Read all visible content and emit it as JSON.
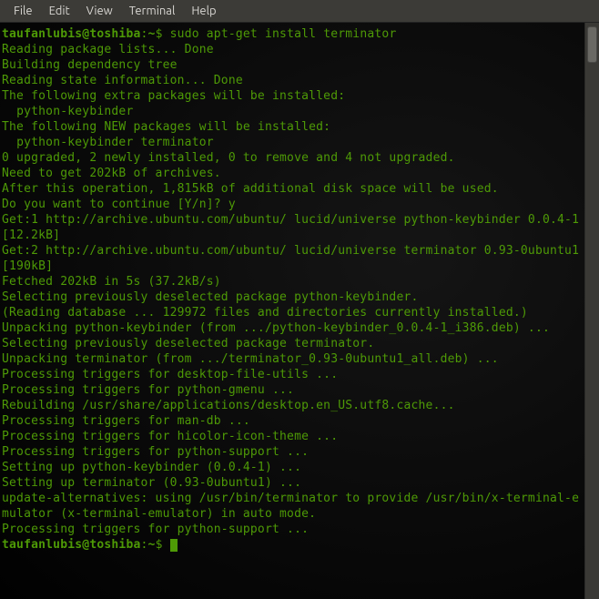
{
  "menubar": {
    "items": [
      "File",
      "Edit",
      "View",
      "Terminal",
      "Help"
    ]
  },
  "prompt": {
    "user_host": "taufanlubis@toshiba",
    "path": "~",
    "symbol": "$"
  },
  "command": "sudo apt-get install terminator",
  "output_lines": [
    "Reading package lists... Done",
    "Building dependency tree       ",
    "Reading state information... Done",
    "The following extra packages will be installed:",
    "  python-keybinder",
    "The following NEW packages will be installed:",
    "  python-keybinder terminator",
    "0 upgraded, 2 newly installed, 0 to remove and 4 not upgraded.",
    "Need to get 202kB of archives.",
    "After this operation, 1,815kB of additional disk space will be used.",
    "Do you want to continue [Y/n]? y",
    "Get:1 http://archive.ubuntu.com/ubuntu/ lucid/universe python-keybinder 0.0.4-1 [12.2kB]",
    "Get:2 http://archive.ubuntu.com/ubuntu/ lucid/universe terminator 0.93-0ubuntu1 [190kB]",
    "Fetched 202kB in 5s (37.2kB/s)",
    "Selecting previously deselected package python-keybinder.",
    "(Reading database ... 129972 files and directories currently installed.)",
    "Unpacking python-keybinder (from .../python-keybinder_0.0.4-1_i386.deb) ...",
    "Selecting previously deselected package terminator.",
    "Unpacking terminator (from .../terminator_0.93-0ubuntu1_all.deb) ...",
    "Processing triggers for desktop-file-utils ...",
    "Processing triggers for python-gmenu ...",
    "Rebuilding /usr/share/applications/desktop.en_US.utf8.cache...",
    "Processing triggers for man-db ...",
    "Processing triggers for hicolor-icon-theme ...",
    "Processing triggers for python-support ...",
    "Setting up python-keybinder (0.0.4-1) ...",
    "",
    "Setting up terminator (0.93-0ubuntu1) ...",
    "update-alternatives: using /usr/bin/terminator to provide /usr/bin/x-terminal-emulator (x-terminal-emulator) in auto mode.",
    "",
    "Processing triggers for python-support ..."
  ]
}
